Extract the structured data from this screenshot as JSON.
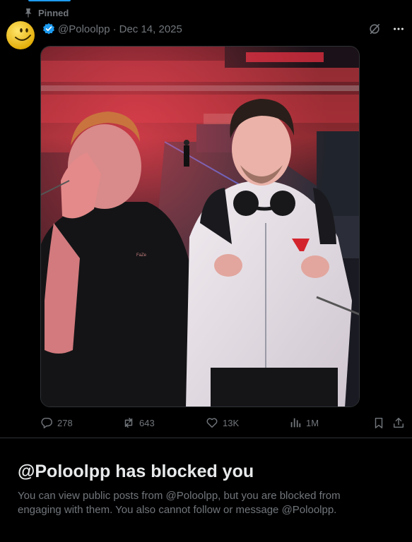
{
  "pinned_label": "Pinned",
  "post": {
    "handle": "@Poloolpp",
    "separator": "·",
    "date": "Dec 14, 2025",
    "header_icons": [
      "grok-icon",
      "more-icon"
    ],
    "media": {
      "description": "Photo of two people posing in an arena with red lighting",
      "shirt_text": "FaZe"
    },
    "actions": {
      "replies": "278",
      "reposts": "643",
      "likes": "13K",
      "views": "1M"
    }
  },
  "blocked": {
    "title": "@Poloolpp has blocked you",
    "description": "You can view public posts from @Poloolpp, but you are blocked from engaging with them. You also cannot follow or message @Poloolpp."
  },
  "colors": {
    "background": "#000000",
    "accent": "#1d9bf0",
    "muted_text": "#71767b",
    "divider": "#2f3336"
  }
}
